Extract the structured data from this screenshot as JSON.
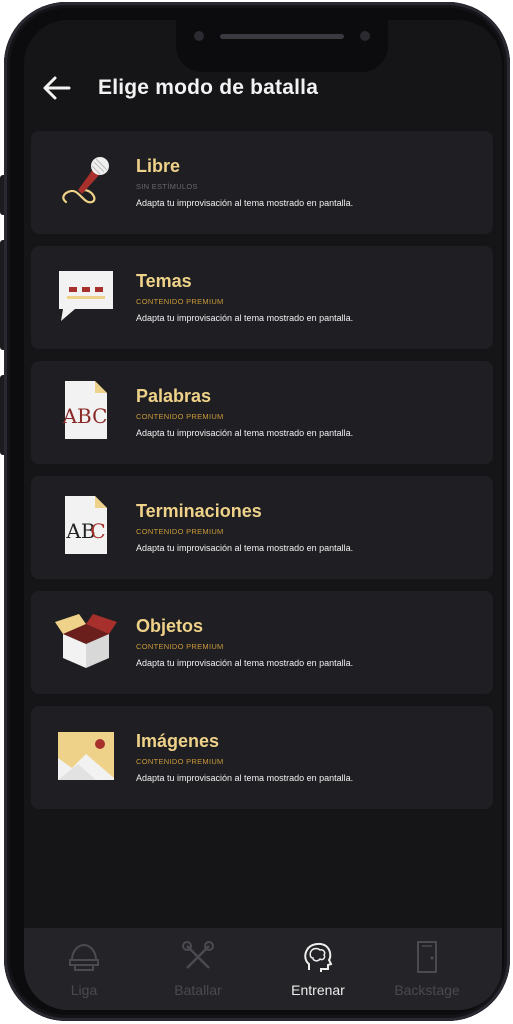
{
  "header": {
    "title": "Elige modo de batalla",
    "back_icon": "arrow-left-icon"
  },
  "modes": [
    {
      "name": "Libre",
      "tag": "SIN ESTÍMULOS",
      "desc": "Adapta tu improvisación al tema mostrado en pantalla.",
      "icon": "microphone-icon",
      "premium": false
    },
    {
      "name": "Temas",
      "tag": "CONTENIDO PREMIUM",
      "desc": "Adapta tu improvisación al tema mostrado en pantalla.",
      "icon": "speech-bubble-icon",
      "premium": true
    },
    {
      "name": "Palabras",
      "tag": "CONTENIDO PREMIUM",
      "desc": "Adapta tu improvisación al tema mostrado en pantalla.",
      "icon": "abc-document-icon",
      "premium": true
    },
    {
      "name": "Terminaciones",
      "tag": "CONTENIDO PREMIUM",
      "desc": "Adapta tu improvisación al tema mostrado en pantalla.",
      "icon": "abc-document-icon",
      "premium": true
    },
    {
      "name": "Objetos",
      "tag": "CONTENIDO PREMIUM",
      "desc": "Adapta tu improvisación al tema mostrado en pantalla.",
      "icon": "open-box-icon",
      "premium": true
    },
    {
      "name": "Imágenes",
      "tag": "CONTENIDO PREMIUM",
      "desc": "Adapta tu improvisación al tema mostrado en pantalla.",
      "icon": "image-icon",
      "premium": true
    }
  ],
  "tabs": [
    {
      "label": "Liga",
      "icon": "helmet-icon",
      "active": false
    },
    {
      "label": "Batallar",
      "icon": "crossed-microphones-icon",
      "active": false
    },
    {
      "label": "Entrenar",
      "icon": "brain-head-icon",
      "active": true
    },
    {
      "label": "Backstage",
      "icon": "door-icon",
      "active": false
    }
  ],
  "colors": {
    "accent": "#efd289",
    "premium": "#c99a3b",
    "card": "#1f1e22",
    "background": "#151417"
  }
}
